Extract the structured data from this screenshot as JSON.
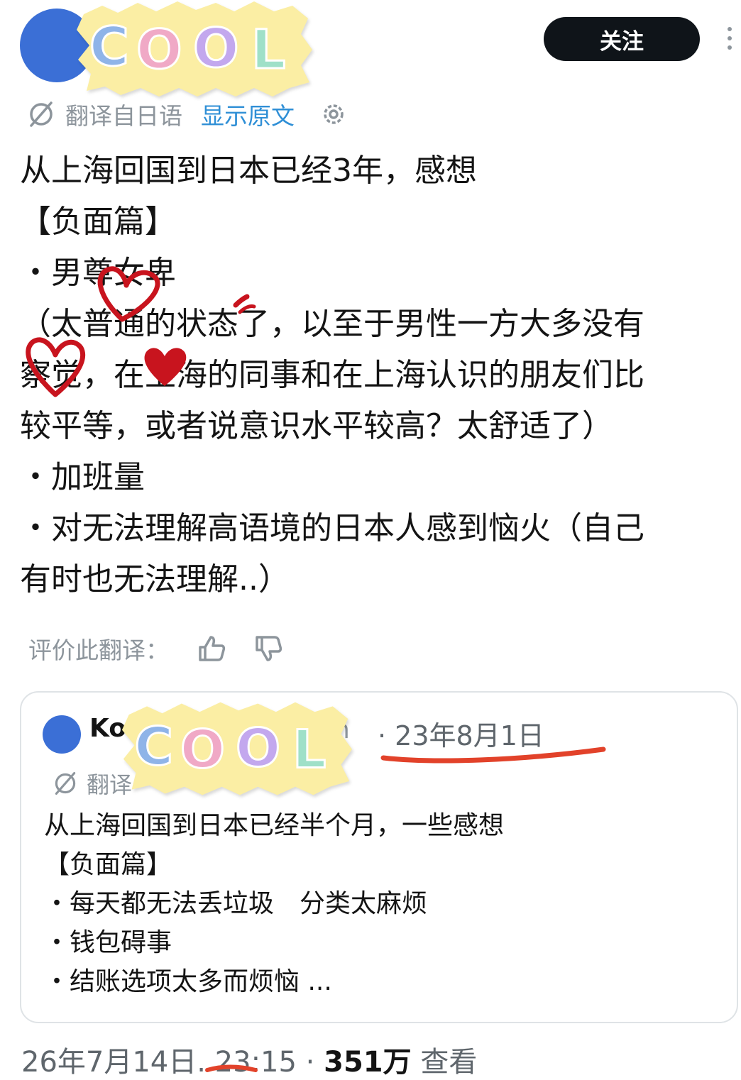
{
  "header": {
    "follow_label": "关注",
    "sticker_text": "COOL"
  },
  "translation": {
    "label": "翻译自日语",
    "show_original": "显示原文"
  },
  "post": {
    "lines": [
      "从上海回国到日本已经3年，感想",
      "【负面篇】",
      "・男尊女卑",
      "（太普通的状态了，以至于男性一方大多没有",
      "察觉，在上海的同事和在上海认识的朋友们比",
      "较平等，或者说意识水平较高？太舒适了）",
      "・加班量",
      "・对无法理解高语境的日本人感到恼火（自己",
      "有时也无法理解..）"
    ]
  },
  "rating": {
    "label": "评价此翻译："
  },
  "quote": {
    "name_visible": "Ko",
    "handle_visible": "h",
    "date": "· 23年8月1日",
    "translate_label": "翻译",
    "lines": [
      "从上海回国到日本已经半个月，一些感想",
      "【负面篇】",
      "・每天都无法丢垃圾　分类太麻烦",
      "・钱包碍事",
      "・结账选项太多而烦恼 ..."
    ]
  },
  "meta": {
    "datetime": "26年7月14日. 23:15 ·",
    "views": "351万",
    "views_label": "查看"
  },
  "colors": {
    "avatar": "#3b6fd6",
    "link": "#2f8fd6",
    "muted": "#8d959c",
    "button": "#0f1419",
    "underline": "#e2422a",
    "hearts": "#c8141e",
    "sticker_bg": "#fbeea4"
  },
  "icons": [
    "translate-icon",
    "gear-icon",
    "more-icon",
    "thumbs-up-icon",
    "thumbs-down-icon",
    "heart-icon"
  ]
}
